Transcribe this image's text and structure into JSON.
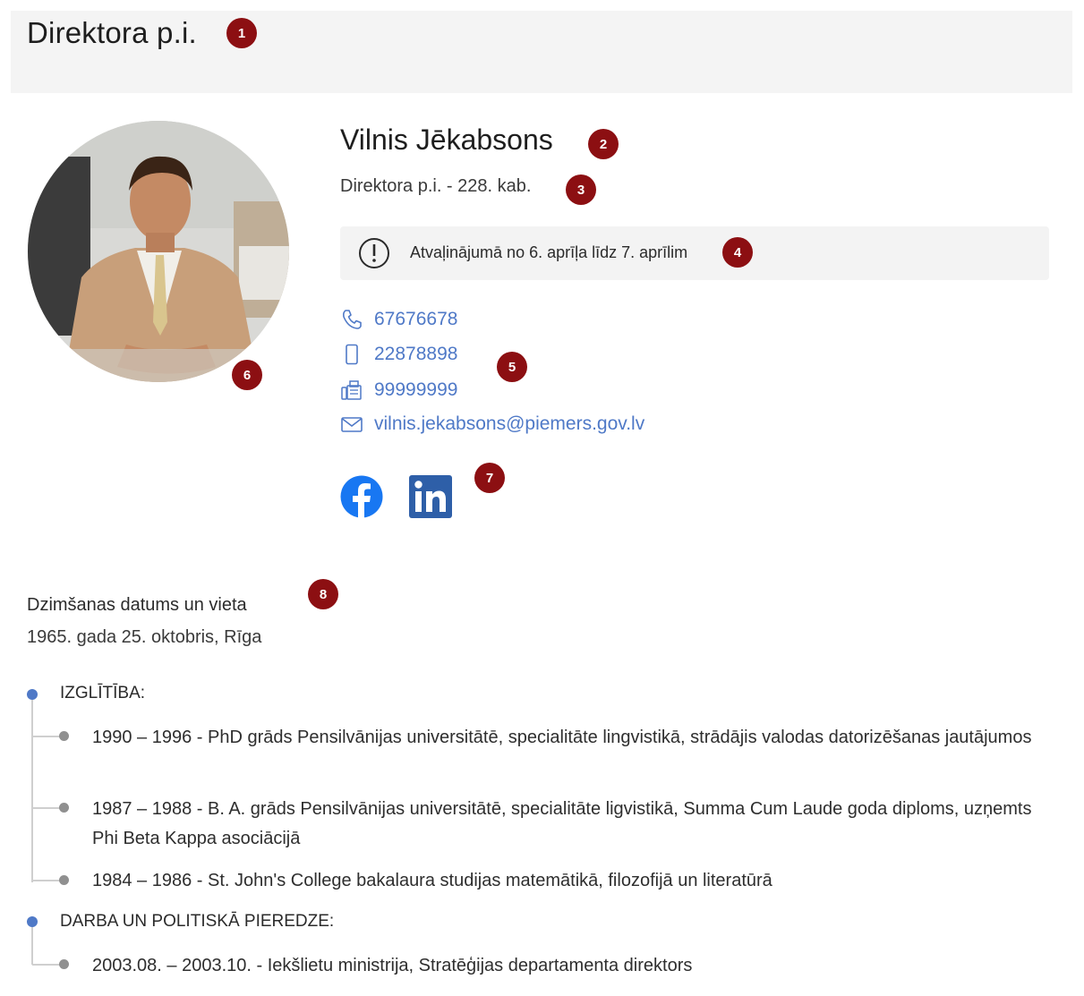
{
  "page": {
    "title": "Direktora p.i."
  },
  "person": {
    "name": "Vilnis Jēkabsons",
    "position": "Direktora p.i.  - 228. kab.",
    "notice": "Atvaļinājumā no 6. aprīļa līdz 7. aprīlim"
  },
  "contacts": [
    {
      "icon": "phone-icon",
      "value": "67676678"
    },
    {
      "icon": "mobile-icon",
      "value": "22878898"
    },
    {
      "icon": "fax-icon",
      "value": "99999999"
    },
    {
      "icon": "email-icon",
      "value": "vilnis.jekabsons@piemers.gov.lv"
    }
  ],
  "social": [
    {
      "icon": "facebook-icon",
      "color": "#1877f2"
    },
    {
      "icon": "linkedin-icon",
      "color": "#2e5fa8"
    }
  ],
  "birth": {
    "label": "Dzimšanas datums un vieta",
    "value": "1965. gada 25. oktobris, Rīga"
  },
  "sections": [
    {
      "heading": "IZGLĪTĪBA:",
      "entries": [
        "1990 – 1996 - PhD grāds Pensilvānijas universitātē, specialitāte lingvistikā, strādājis valodas datorizēšanas jautājumos",
        "1987 – 1988 - B. A. grāds Pensilvānijas universitātē, specialitāte ligvistikā, Summa Cum Laude goda diploms, uzņemts Phi Beta Kappa asociācijā",
        "1984 – 1986 - St. John's College bakalaura studijas matemātikā, filozofijā un literatūrā"
      ]
    },
    {
      "heading": "DARBA UN POLITISKĀ PIEREDZE:",
      "entries": [
        "2003.08. – 2003.10. - Iekšlietu ministrija, Stratēģijas departamenta direktors"
      ]
    }
  ],
  "markers": [
    "1",
    "2",
    "3",
    "4",
    "5",
    "6",
    "7",
    "8"
  ],
  "colors": {
    "link": "#4f79c7",
    "marker": "#8c0f12",
    "timeline_dot_active": "#4f79c7",
    "timeline_dot": "#909090"
  }
}
